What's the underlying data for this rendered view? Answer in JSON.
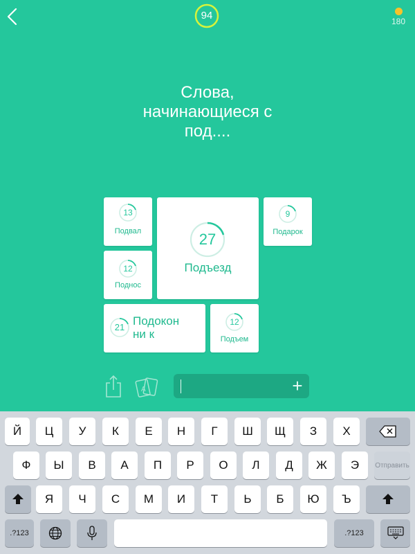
{
  "header": {
    "level": "94",
    "coins": "180"
  },
  "question": {
    "line1": "Слова,",
    "line2": "начинающиеся с",
    "line3": "под...."
  },
  "tiles": [
    {
      "count": "13",
      "word": "Подвал"
    },
    {
      "count": "27",
      "word": "Подъезд"
    },
    {
      "count": "9",
      "word": "Подарок"
    },
    {
      "count": "12",
      "word": "Поднос"
    },
    {
      "count": "21",
      "word": "Подоконни к"
    },
    {
      "count": "12",
      "word": "Подъем"
    }
  ],
  "keyboard": {
    "row1": [
      "Й",
      "Ц",
      "У",
      "К",
      "Е",
      "Н",
      "Г",
      "Ш",
      "Щ",
      "З",
      "Х"
    ],
    "row2": [
      "Ф",
      "Ы",
      "В",
      "А",
      "П",
      "Р",
      "О",
      "Л",
      "Д",
      "Ж",
      "Э"
    ],
    "row3": [
      "Я",
      "Ч",
      "С",
      "М",
      "И",
      "Т",
      "Ь",
      "Б",
      "Ю",
      "Ъ"
    ],
    "send_label": "Отправить",
    "numbers_label": ".?123",
    "numbers_label_right": ".?123"
  },
  "icons": {
    "back": "chevron-left-icon",
    "share": "share-icon",
    "cards": "cards-icon",
    "plus": "plus-icon",
    "backspace": "backspace-icon",
    "shift": "shift-icon",
    "globe": "globe-icon",
    "mic": "microphone-icon",
    "hide_keyboard": "keyboard-hide-icon"
  },
  "colors": {
    "background": "#24c79c",
    "tile": "#ffffff",
    "accent_text": "#1fb98e",
    "coin": "#f7c32b",
    "level_ring": "#d7f33b",
    "input_field": "#1da883"
  }
}
